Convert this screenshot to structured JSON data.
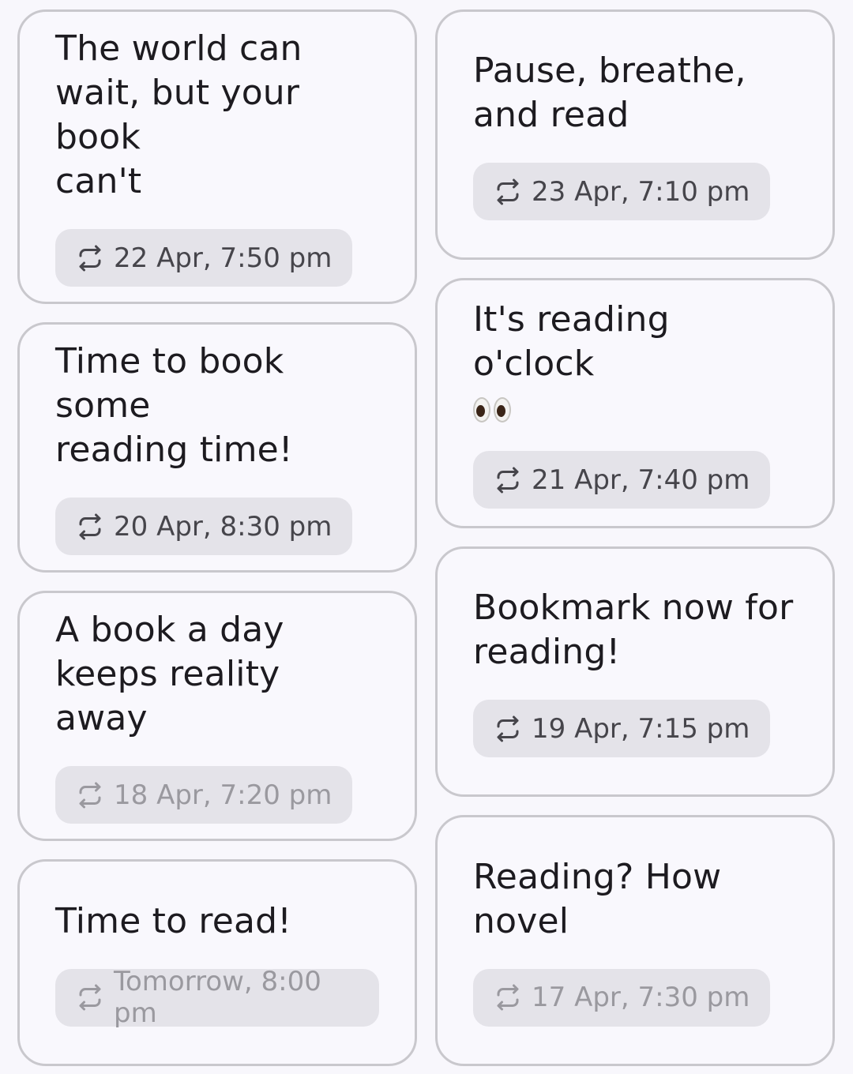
{
  "cards": [
    {
      "title": "The world can\nwait, but your book\ncan't",
      "chip": "22 Apr, 7:50 pm",
      "dim": false
    },
    {
      "title": "Pause, breathe,\nand read",
      "chip": "23 Apr, 7:10 pm",
      "dim": false
    },
    {
      "title": "Time to book some\nreading time!",
      "chip": "20 Apr, 8:30 pm",
      "dim": false
    },
    {
      "title": "It's reading o'clock",
      "emoji_icon": "eyes-icon",
      "chip": "21 Apr, 7:40 pm",
      "dim": false
    },
    {
      "title": "A book a day\nkeeps reality away",
      "chip": "18 Apr, 7:20 pm",
      "dim": true
    },
    {
      "title": "Bookmark now for\nreading!",
      "chip": "19 Apr, 7:15 pm",
      "dim": false
    },
    {
      "title": "Time to read!",
      "chip": "Tomorrow, 8:00 pm",
      "dim": true
    },
    {
      "title": "Reading? How\nnovel",
      "chip": "17 Apr, 7:30 pm",
      "dim": true
    }
  ],
  "icons": {
    "chip_icon": "repeat-icon"
  },
  "colors": {
    "background": "#f8f7fc",
    "chip_bg": "#e4e3e9",
    "border": "#c9c8cd",
    "text": "#1d1b20"
  }
}
